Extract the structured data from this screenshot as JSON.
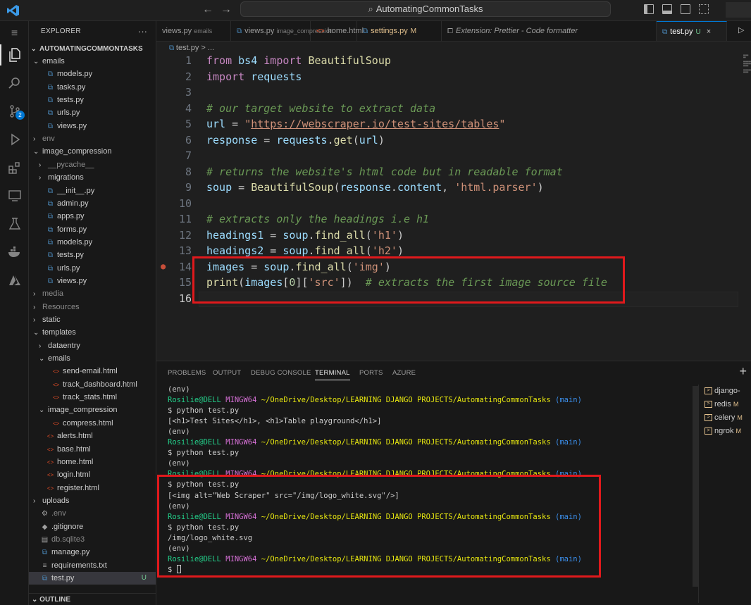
{
  "titlebar": {
    "title": "AutomatingCommonTasks",
    "back_icon": "arrow-left-icon",
    "forward_icon": "arrow-right-icon"
  },
  "activity": {
    "scm_badge": "2"
  },
  "explorer": {
    "header": "EXPLORER",
    "more": "···",
    "root": "AUTOMATINGCOMMONTASKS",
    "outline": "OUTLINE",
    "items": [
      {
        "label": "emails",
        "kind": "folder-open",
        "depth": 1
      },
      {
        "label": "models.py",
        "kind": "py",
        "depth": 2
      },
      {
        "label": "tasks.py",
        "kind": "py",
        "depth": 2
      },
      {
        "label": "tests.py",
        "kind": "py",
        "depth": 2
      },
      {
        "label": "urls.py",
        "kind": "py",
        "depth": 2
      },
      {
        "label": "views.py",
        "kind": "py",
        "depth": 2
      },
      {
        "label": "env",
        "kind": "folder",
        "depth": 1,
        "dim": true
      },
      {
        "label": "image_compression",
        "kind": "folder-open",
        "depth": 1
      },
      {
        "label": "__pycache__",
        "kind": "folder",
        "depth": 2,
        "dim": true
      },
      {
        "label": "migrations",
        "kind": "folder",
        "depth": 2
      },
      {
        "label": "__init__.py",
        "kind": "py",
        "depth": 2
      },
      {
        "label": "admin.py",
        "kind": "py",
        "depth": 2
      },
      {
        "label": "apps.py",
        "kind": "py",
        "depth": 2
      },
      {
        "label": "forms.py",
        "kind": "py",
        "depth": 2
      },
      {
        "label": "models.py",
        "kind": "py",
        "depth": 2
      },
      {
        "label": "tests.py",
        "kind": "py",
        "depth": 2
      },
      {
        "label": "urls.py",
        "kind": "py",
        "depth": 2
      },
      {
        "label": "views.py",
        "kind": "py",
        "depth": 2
      },
      {
        "label": "media",
        "kind": "folder",
        "depth": 1,
        "dim": true
      },
      {
        "label": "Resources",
        "kind": "folder",
        "depth": 1,
        "dim": true
      },
      {
        "label": "static",
        "kind": "folder",
        "depth": 1
      },
      {
        "label": "templates",
        "kind": "folder-open",
        "depth": 1
      },
      {
        "label": "dataentry",
        "kind": "folder",
        "depth": 2
      },
      {
        "label": "emails",
        "kind": "folder-open",
        "depth": 2
      },
      {
        "label": "send-email.html",
        "kind": "html",
        "depth": 3
      },
      {
        "label": "track_dashboard.html",
        "kind": "html",
        "depth": 3
      },
      {
        "label": "track_stats.html",
        "kind": "html",
        "depth": 3
      },
      {
        "label": "image_compression",
        "kind": "folder-open",
        "depth": 2
      },
      {
        "label": "compress.html",
        "kind": "html",
        "depth": 3
      },
      {
        "label": "alerts.html",
        "kind": "html",
        "depth": 2
      },
      {
        "label": "base.html",
        "kind": "html",
        "depth": 2
      },
      {
        "label": "home.html",
        "kind": "html",
        "depth": 2
      },
      {
        "label": "login.html",
        "kind": "html",
        "depth": 2
      },
      {
        "label": "register.html",
        "kind": "html",
        "depth": 2
      },
      {
        "label": "uploads",
        "kind": "folder",
        "depth": 1
      },
      {
        "label": ".env",
        "kind": "env",
        "depth": 1,
        "dim": true
      },
      {
        "label": ".gitignore",
        "kind": "git",
        "depth": 1
      },
      {
        "label": "db.sqlite3",
        "kind": "db",
        "depth": 1,
        "dim": true
      },
      {
        "label": "manage.py",
        "kind": "py",
        "depth": 1
      },
      {
        "label": "requirements.txt",
        "kind": "txt",
        "depth": 1
      },
      {
        "label": "test.py",
        "kind": "py",
        "depth": 1,
        "selected": true,
        "status": "U"
      }
    ]
  },
  "tabs": [
    {
      "label": "views.py",
      "desc": "emails"
    },
    {
      "label": "views.py",
      "desc": "image_compression"
    },
    {
      "label": "home.html",
      "desc": ""
    },
    {
      "label": "settings.py",
      "desc": "",
      "badge": "M"
    },
    {
      "label": "Extension: Prettier - Code formatter",
      "desc": ""
    },
    {
      "label": "test.py",
      "desc": "",
      "badge": "U",
      "active": true
    }
  ],
  "breadcrumb": {
    "file": "test.py",
    "sep": ">",
    "rest": "..."
  },
  "editor": {
    "current_line": 16,
    "breakpoint_line": 14,
    "lines": [
      [
        [
          "kw",
          "from"
        ],
        [
          "t",
          " "
        ],
        [
          "var",
          "bs4"
        ],
        [
          "t",
          " "
        ],
        [
          "kw",
          "import"
        ],
        [
          "t",
          " "
        ],
        [
          "fn",
          "BeautifulSoup"
        ]
      ],
      [
        [
          "kw",
          "import"
        ],
        [
          "t",
          " "
        ],
        [
          "var",
          "requests"
        ]
      ],
      [],
      [
        [
          "cm",
          "# our target website to extract data"
        ]
      ],
      [
        [
          "var",
          "url"
        ],
        [
          "t",
          " = "
        ],
        [
          "str",
          "\""
        ],
        [
          "url",
          "https://webscraper.io/test-sites/tables"
        ],
        [
          "str",
          "\""
        ]
      ],
      [
        [
          "var",
          "response"
        ],
        [
          "t",
          " = "
        ],
        [
          "var",
          "requests"
        ],
        [
          "t",
          "."
        ],
        [
          "fn",
          "get"
        ],
        [
          "t",
          "("
        ],
        [
          "var",
          "url"
        ],
        [
          "t",
          ")"
        ]
      ],
      [],
      [
        [
          "cm",
          "# returns the website's html code but in readable format"
        ]
      ],
      [
        [
          "var",
          "soup"
        ],
        [
          "t",
          " = "
        ],
        [
          "fn",
          "BeautifulSoup"
        ],
        [
          "t",
          "("
        ],
        [
          "var",
          "response"
        ],
        [
          "t",
          "."
        ],
        [
          "var",
          "content"
        ],
        [
          "t",
          ", "
        ],
        [
          "str",
          "'html.parser'"
        ],
        [
          "t",
          ")"
        ]
      ],
      [],
      [
        [
          "cm",
          "# extracts only the headings i.e h1"
        ]
      ],
      [
        [
          "var",
          "headings1"
        ],
        [
          "t",
          " = "
        ],
        [
          "var",
          "soup"
        ],
        [
          "t",
          "."
        ],
        [
          "fn",
          "find_all"
        ],
        [
          "t",
          "("
        ],
        [
          "str",
          "'h1'"
        ],
        [
          "t",
          ")"
        ]
      ],
      [
        [
          "var",
          "headings2"
        ],
        [
          "t",
          " = "
        ],
        [
          "var",
          "soup"
        ],
        [
          "t",
          "."
        ],
        [
          "fn",
          "find_all"
        ],
        [
          "t",
          "("
        ],
        [
          "str",
          "'h2'"
        ],
        [
          "t",
          ")"
        ]
      ],
      [
        [
          "var",
          "images"
        ],
        [
          "t",
          " = "
        ],
        [
          "var",
          "soup"
        ],
        [
          "t",
          "."
        ],
        [
          "fn",
          "find_all"
        ],
        [
          "t",
          "("
        ],
        [
          "str",
          "'img'"
        ],
        [
          "t",
          ")"
        ]
      ],
      [
        [
          "fn",
          "print"
        ],
        [
          "t",
          "("
        ],
        [
          "var",
          "images"
        ],
        [
          "t",
          "["
        ],
        [
          "num",
          "0"
        ],
        [
          "t",
          "]["
        ],
        [
          "str",
          "'src'"
        ],
        [
          "t",
          "])"
        ],
        [
          "t",
          "  "
        ],
        [
          "cm",
          "# extracts the first image source file"
        ]
      ],
      []
    ]
  },
  "panel": {
    "tabs": [
      "PROBLEMS",
      "OUTPUT",
      "DEBUG CONSOLE",
      "TERMINAL",
      "PORTS",
      "AZURE"
    ],
    "active_tab": "TERMINAL",
    "add": "+",
    "prompt": {
      "user": "Rosilie@DELL",
      "host": "MINGW64",
      "path": "~/OneDrive/Desktop/LEARNING DJANGO PROJECTS/AutomatingCommonTasks",
      "branch": "(main)"
    },
    "terminal": [
      {
        "type": "text",
        "text": "(env)"
      },
      {
        "type": "prompt"
      },
      {
        "type": "text",
        "text": "$ python test.py"
      },
      {
        "type": "text",
        "text": "[<h1>Test Sites</h1>, <h1>Table playground</h1>]"
      },
      {
        "type": "text",
        "text": "(env)"
      },
      {
        "type": "prompt"
      },
      {
        "type": "text",
        "text": "$ python test.py"
      },
      {
        "type": "text",
        "text": "(env)"
      },
      {
        "type": "prompt"
      },
      {
        "type": "text",
        "text": "$ python test.py"
      },
      {
        "type": "text",
        "text": "[<img alt=\"Web Scraper\" src=\"/img/logo_white.svg\"/>]"
      },
      {
        "type": "text",
        "text": "(env)"
      },
      {
        "type": "prompt"
      },
      {
        "type": "text",
        "text": "$ python test.py"
      },
      {
        "type": "text",
        "text": "/img/logo_white.svg"
      },
      {
        "type": "text",
        "text": "(env)"
      },
      {
        "type": "prompt"
      },
      {
        "type": "input",
        "text": "$ "
      }
    ],
    "terminals": [
      {
        "label": "django-",
        "badge": ""
      },
      {
        "label": "redis",
        "badge": "M"
      },
      {
        "label": "celery",
        "badge": "M"
      },
      {
        "label": "ngrok",
        "badge": "M"
      }
    ]
  }
}
